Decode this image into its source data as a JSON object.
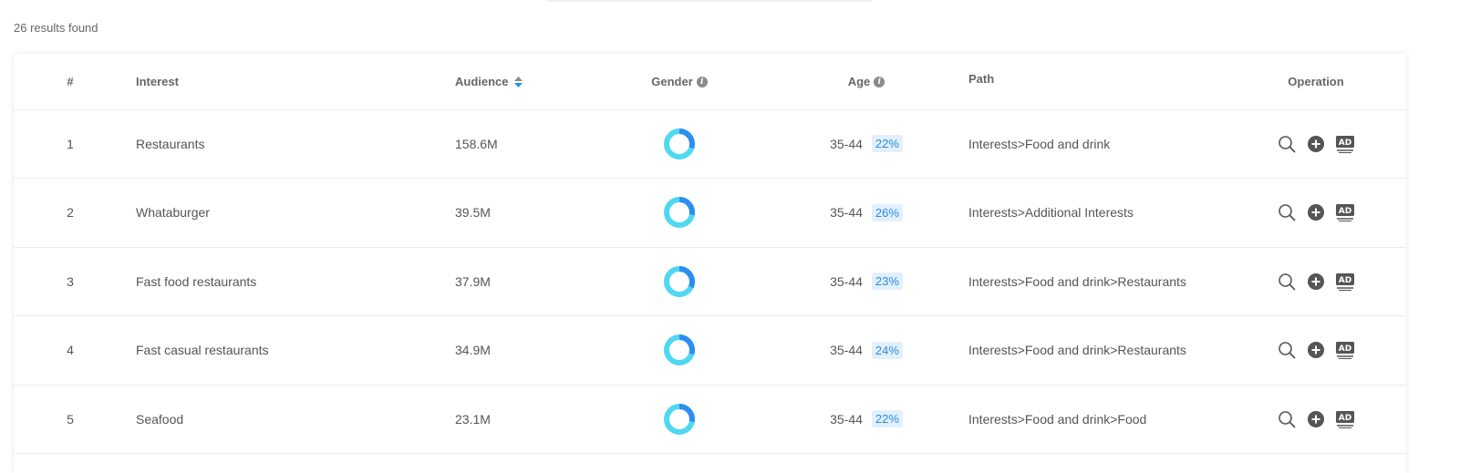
{
  "results_text": "26 results found",
  "headers": {
    "num": "#",
    "interest": "Interest",
    "audience": "Audience",
    "gender": "Gender",
    "age": "Age",
    "path": "Path",
    "operation": "Operation"
  },
  "rows": [
    {
      "num": "1",
      "interest": "Restaurants",
      "audience": "158.6M",
      "age": "35-44",
      "age_pct": "22%",
      "path": "Interests>Food and drink",
      "male_fraction": 0.3
    },
    {
      "num": "2",
      "interest": "Whataburger",
      "audience": "39.5M",
      "age": "35-44",
      "age_pct": "26%",
      "path": "Interests>Additional Interests",
      "male_fraction": 0.28
    },
    {
      "num": "3",
      "interest": "Fast food restaurants",
      "audience": "37.9M",
      "age": "35-44",
      "age_pct": "23%",
      "path": "Interests>Food and drink>Restaurants",
      "male_fraction": 0.32
    },
    {
      "num": "4",
      "interest": "Fast casual restaurants",
      "audience": "34.9M",
      "age": "35-44",
      "age_pct": "24%",
      "path": "Interests>Food and drink>Restaurants",
      "male_fraction": 0.3
    },
    {
      "num": "5",
      "interest": "Seafood",
      "audience": "23.1M",
      "age": "35-44",
      "age_pct": "22%",
      "path": "Interests>Food and drink>Food",
      "male_fraction": 0.28
    }
  ],
  "colors": {
    "donut_male": "#2e8ef0",
    "donut_female": "#4fd8f2",
    "badge_text": "#2b8ae6",
    "badge_bg": "#e2f0fc",
    "icon": "#555555"
  },
  "icons": {
    "gender_info": "info-icon",
    "age_info": "info-icon",
    "audience_sort": "sort-icon",
    "op_search": "search-icon",
    "op_add": "plus-circle-icon",
    "op_ad": "ad-icon"
  }
}
